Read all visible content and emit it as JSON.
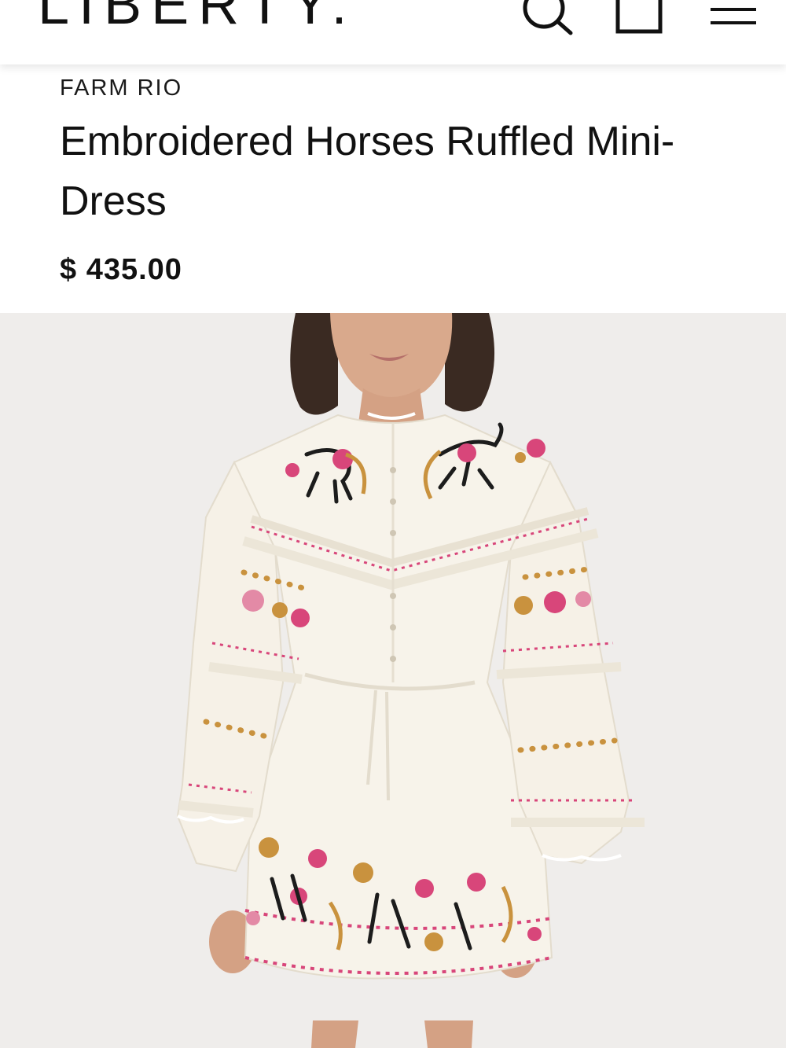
{
  "header": {
    "logo_text": "LIBERTY.",
    "search_icon": "search-icon",
    "bag_icon": "shopping-bag-icon",
    "menu_icon": "menu-icon"
  },
  "product": {
    "brand": "FARM RIO",
    "title": "Embroidered Horses Ruffled Mini-Dress",
    "price": "$ 435.00"
  },
  "colors": {
    "background": "#ffffff",
    "image_background": "#efedeb",
    "text": "#111111",
    "dress": "#f7f3ea",
    "embroidery_pink": "#d8467a",
    "embroidery_gold": "#c9923e",
    "embroidery_black": "#1c1c1c"
  }
}
